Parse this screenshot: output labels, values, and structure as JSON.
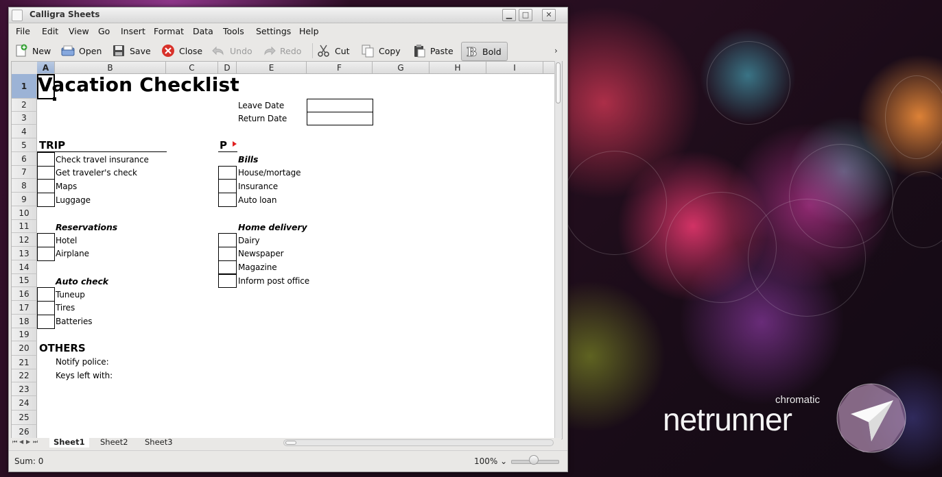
{
  "window": {
    "title": "Calligra Sheets"
  },
  "menu": [
    "File",
    "Edit",
    "View",
    "Go",
    "Insert",
    "Format",
    "Data",
    "Tools",
    "Settings",
    "Help"
  ],
  "toolbar": {
    "new": "New",
    "open": "Open",
    "save": "Save",
    "close": "Close",
    "undo": "Undo",
    "redo": "Redo",
    "cut": "Cut",
    "copy": "Copy",
    "paste": "Paste",
    "bold": "Bold",
    "more": "›"
  },
  "columns": [
    "A",
    "B",
    "C",
    "D",
    "E",
    "F",
    "G",
    "H",
    "I"
  ],
  "rows": [
    "1",
    "2",
    "3",
    "4",
    "5",
    "6",
    "7",
    "8",
    "9",
    "10",
    "11",
    "12",
    "13",
    "14",
    "15",
    "16",
    "17",
    "18",
    "19",
    "20",
    "21",
    "22",
    "23",
    "24",
    "25",
    "26"
  ],
  "sheet": {
    "title": "Vacation Checklist",
    "leave_date": "Leave Date",
    "return_date": "Return Date",
    "trip": "TRIP",
    "trip_items": [
      "Check travel insurance",
      "Get traveler's check",
      "Maps",
      "Luggage"
    ],
    "reservations": "Reservations",
    "reservation_items": [
      "Hotel",
      "Airplane"
    ],
    "auto_check": "Auto check",
    "auto_items": [
      "Tuneup",
      "Tires",
      "Batteries"
    ],
    "others": "OTHERS",
    "other_items": [
      "Notify police:",
      "Keys left with:"
    ],
    "p_head": "P",
    "bills": "Bills",
    "bill_items": [
      "House/mortage",
      "Insurance",
      "Auto loan"
    ],
    "home_delivery": "Home delivery",
    "delivery_items": [
      "Dairy",
      "Newspaper",
      "Magazine",
      "Inform post office"
    ]
  },
  "tabs": [
    "Sheet1",
    "Sheet2",
    "Sheet3"
  ],
  "status": {
    "sum": "Sum: 0",
    "zoom": "100% ⌄"
  },
  "branding": {
    "small": "chromatic",
    "main": "netrunner"
  }
}
